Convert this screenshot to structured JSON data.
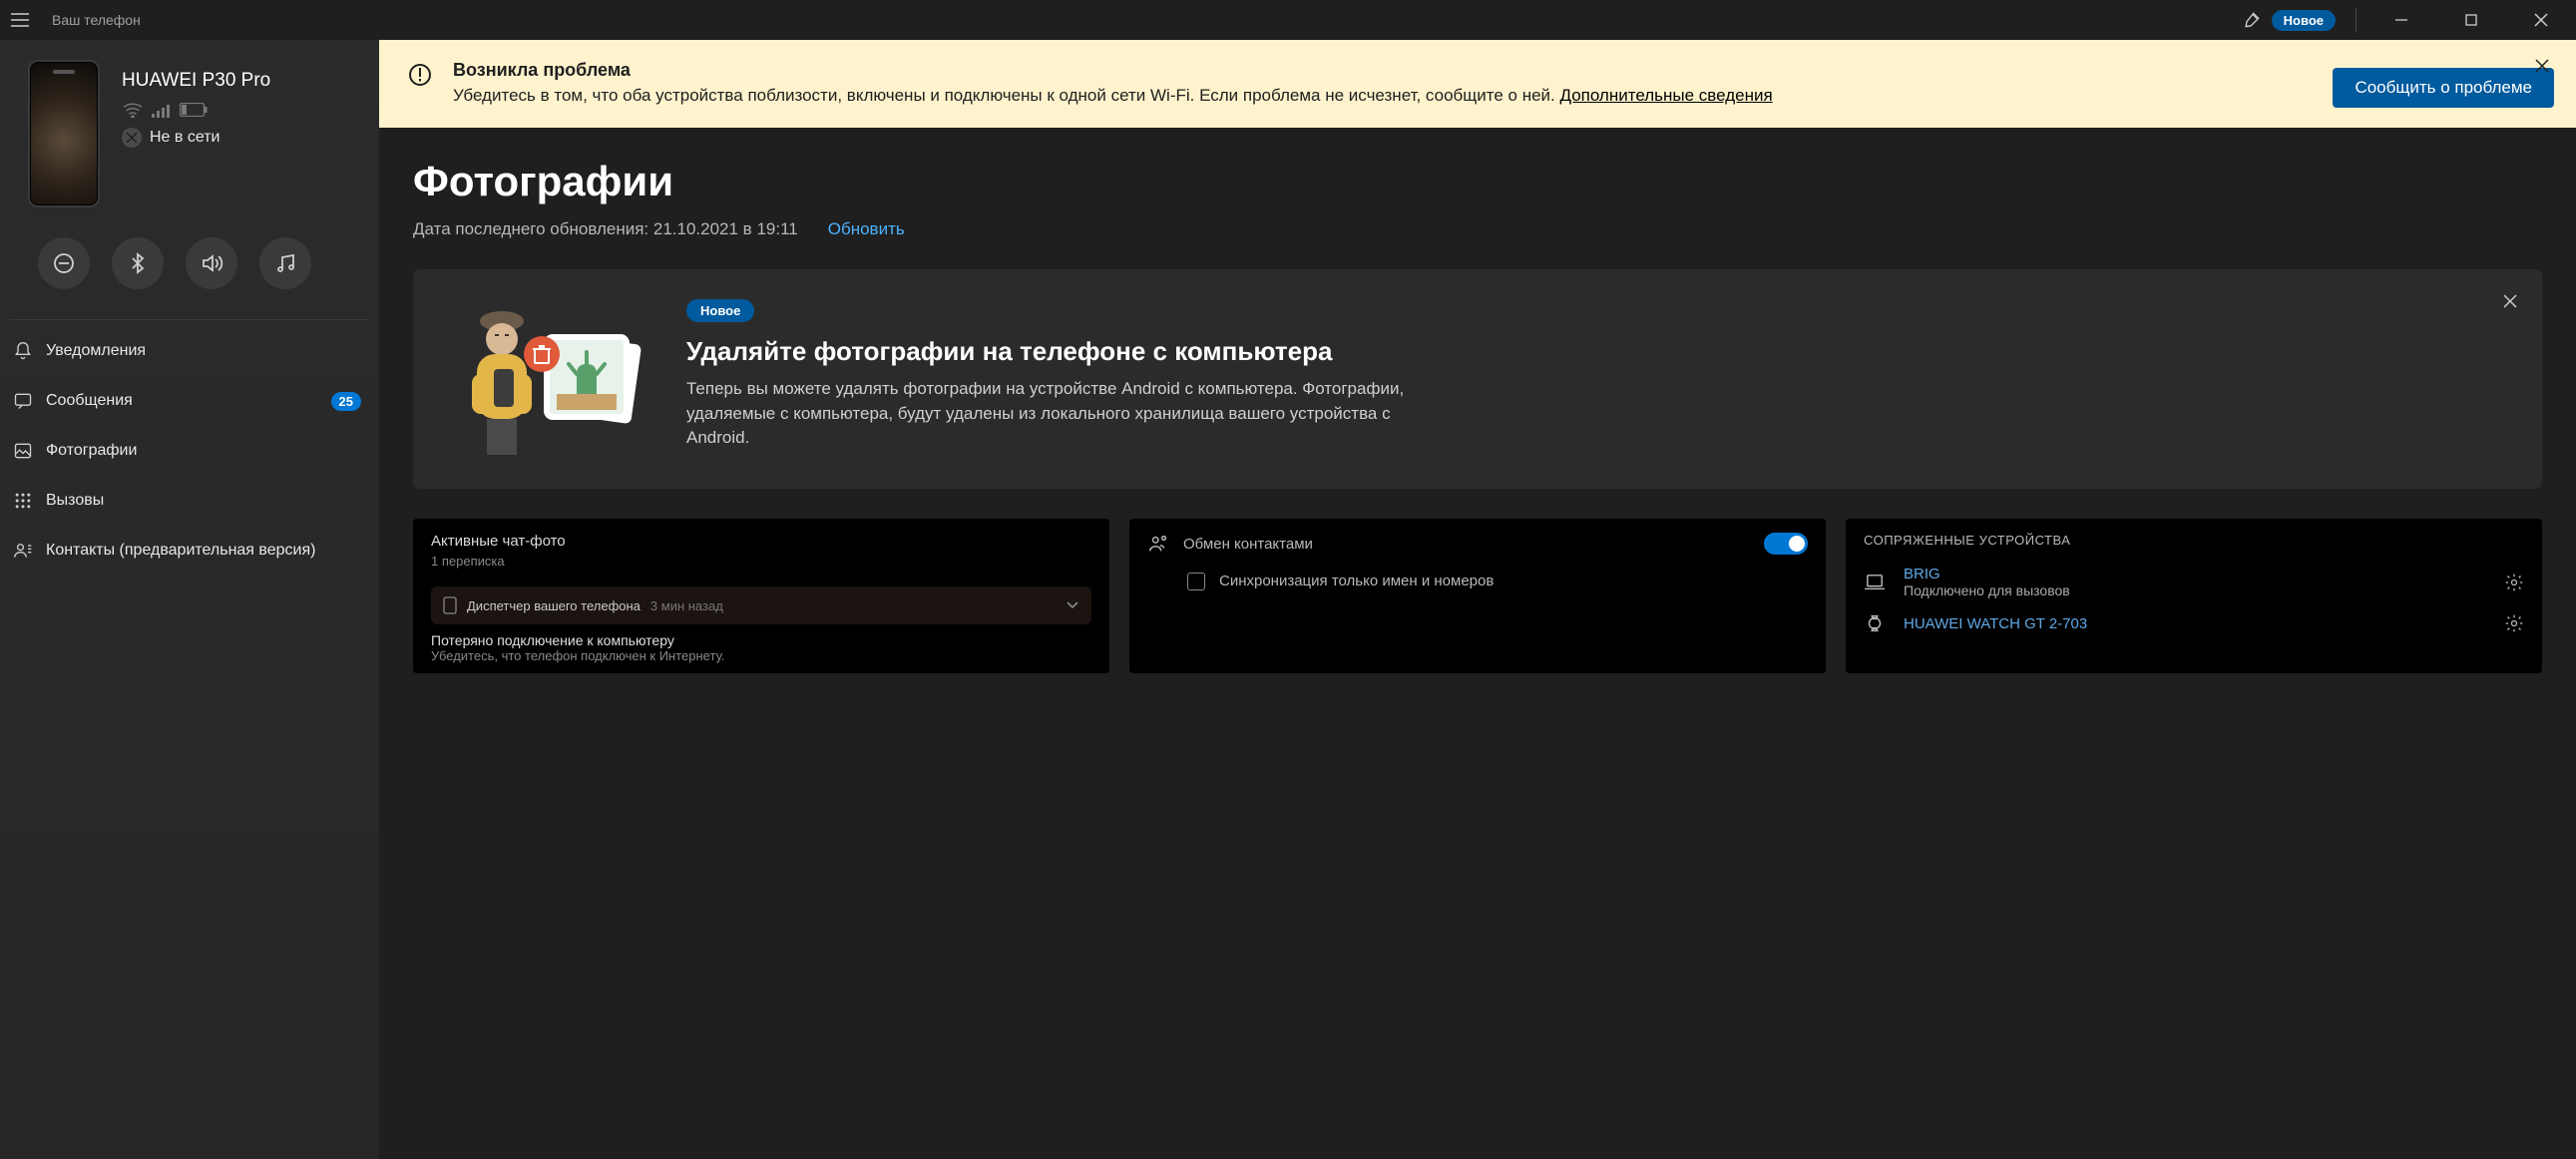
{
  "titlebar": {
    "app_name": "Ваш телефон",
    "new_badge": "Новое"
  },
  "device": {
    "name": "HUAWEI P30 Pro",
    "status": "Не в сети"
  },
  "sidebar": {
    "notifications": "Уведомления",
    "messages": "Сообщения",
    "messages_badge": "25",
    "photos": "Фотографии",
    "calls": "Вызовы",
    "contacts": "Контакты (предварительная версия)"
  },
  "banner": {
    "title": "Возникла проблема",
    "text_pre": "Убедитесь в том, что оба устройства поблизости, включены и подключены к одной сети Wi-Fi. Если проблема не исчезнет, сообщите о ней. ",
    "link": "Дополнительные сведения",
    "button": "Сообщить о проблеме"
  },
  "page": {
    "title": "Фотографии",
    "last_updated_label": "Дата последнего обновления: 21.10.2021 в 19:11",
    "refresh": "Обновить"
  },
  "promo": {
    "badge": "Новое",
    "title": "Удаляйте фотографии на телефоне с компьютера",
    "text": "Теперь вы можете удалять фотографии на устройстве Android с компьютера. Фотографии, удаляемые с компьютера, будут удалены из локального хранилища вашего устройства с Android."
  },
  "tiles": {
    "t1": {
      "title": "Активные чат-фото",
      "sub": "1 переписка",
      "row_app": "Диспетчер вашего телефона",
      "row_time": "3 мин назад",
      "row_msg": "Потеряно подключение к компьютеру",
      "row_hint": "Убедитесь, что телефон подключен к Интернету."
    },
    "t2": {
      "label": "Обмен контактами",
      "sync_label": "Синхронизация только имен и номеров"
    },
    "t3": {
      "header": "СОПРЯЖЕННЫЕ УСТРОЙСТВА",
      "dev1_name": "BRIG",
      "dev1_sub": "Подключено для вызовов",
      "dev2_name": "HUAWEI WATCH GT 2-703"
    }
  }
}
